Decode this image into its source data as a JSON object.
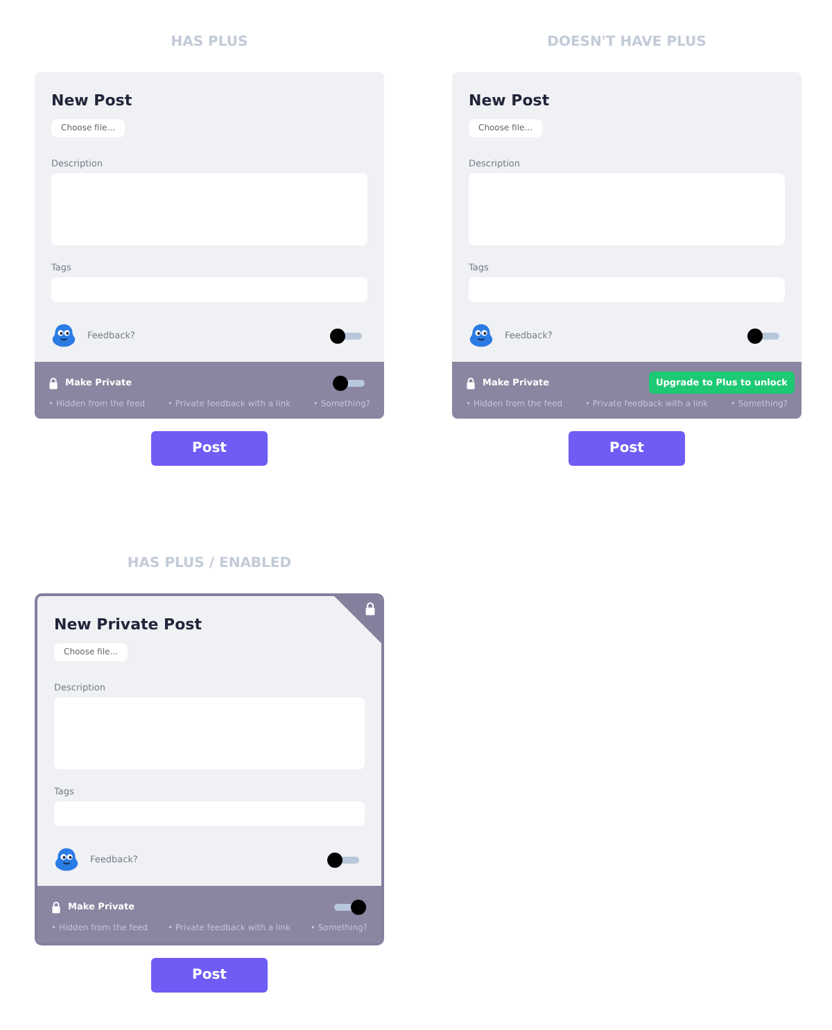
{
  "panels": [
    {
      "heading": "HAS PLUS",
      "enabled": false,
      "title": "New Post",
      "choose_file": "Choose file...",
      "description_label": "Description",
      "tags_label": "Tags",
      "feedback": {
        "label": "Feedback?",
        "on": false
      },
      "private": {
        "label": "Make Private",
        "kind": "toggle",
        "on": false,
        "bullets": [
          "• Hidden from the feed",
          "• Private feedback with a link",
          "• Something?"
        ]
      },
      "post_button": "Post"
    },
    {
      "heading": "DOESN'T HAVE PLUS",
      "enabled": false,
      "title": "New Post",
      "choose_file": "Choose file...",
      "description_label": "Description",
      "tags_label": "Tags",
      "feedback": {
        "label": "Feedback?",
        "on": false
      },
      "private": {
        "label": "Make Private",
        "kind": "upgrade",
        "upgrade_button": "Upgrade to Plus to unlock",
        "bullets": [
          "• Hidden from the feed",
          "• Private feedback with a link",
          "• Something?"
        ]
      },
      "post_button": "Post"
    },
    {
      "heading": "HAS PLUS / ENABLED",
      "enabled": true,
      "title": "New Private Post",
      "choose_file": "Choose file...",
      "description_label": "Description",
      "tags_label": "Tags",
      "feedback": {
        "label": "Feedback?",
        "on": false
      },
      "private": {
        "label": "Make Private",
        "kind": "toggle",
        "on": true,
        "bullets": [
          "• Hidden from the feed",
          "• Private feedback with a link",
          "• Something?"
        ]
      },
      "post_button": "Post"
    }
  ]
}
